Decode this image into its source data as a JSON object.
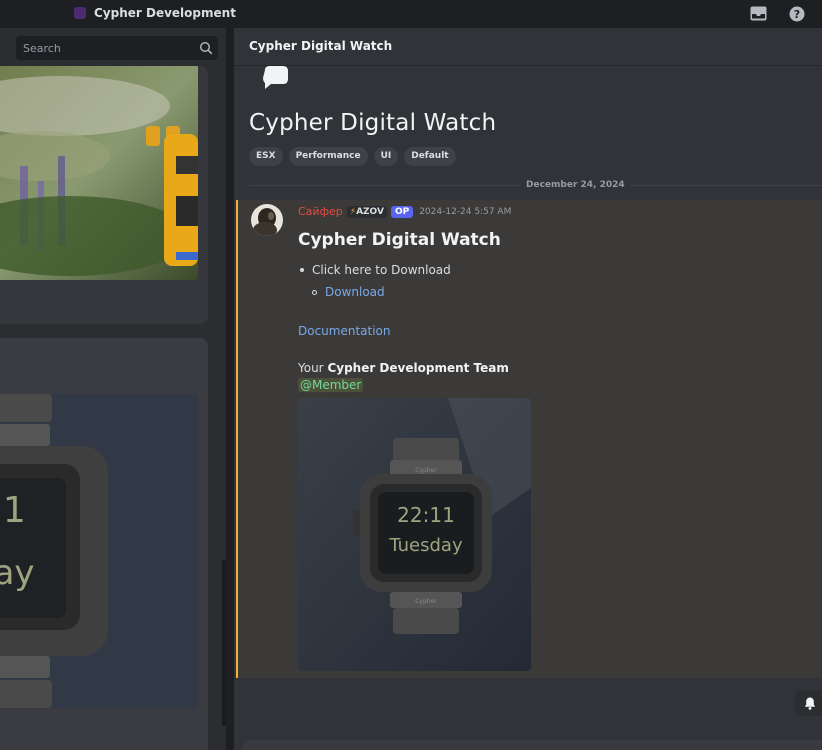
{
  "topbar": {
    "server_title": "Cypher Development",
    "inbox_icon": "inbox-icon",
    "help_icon": "help-icon"
  },
  "sidebar": {
    "search_placeholder": "Search"
  },
  "thread": {
    "header_title": "Cypher Digital Watch",
    "post_title": "Cypher Digital Watch",
    "tags": [
      "ESX",
      "Performance",
      "UI",
      "Default"
    ],
    "date_divider": "December 24, 2024"
  },
  "message": {
    "author": "Сайфер",
    "role_tag": "AZOV",
    "op_badge": "OP",
    "timestamp": "2024-12-24 5:57 AM",
    "heading": "Cypher Digital Watch",
    "list_item": "Click here to Download",
    "sub_item_link": "Download",
    "doc_link": "Documentation",
    "team_prefix": "Your ",
    "team_name": "Cypher Development Team",
    "mention": "@Member",
    "watch_time": "22:11",
    "watch_day": "Tuesday",
    "watch_brand": "Cypher"
  },
  "preview": {
    "watch_time_partial": "11",
    "watch_day_partial": "day"
  },
  "colors": {
    "accent_border": "#f0b232",
    "author": "#e74c3c",
    "link": "#79a8e8",
    "mention": "#73d996",
    "op_badge": "#5865f2"
  }
}
